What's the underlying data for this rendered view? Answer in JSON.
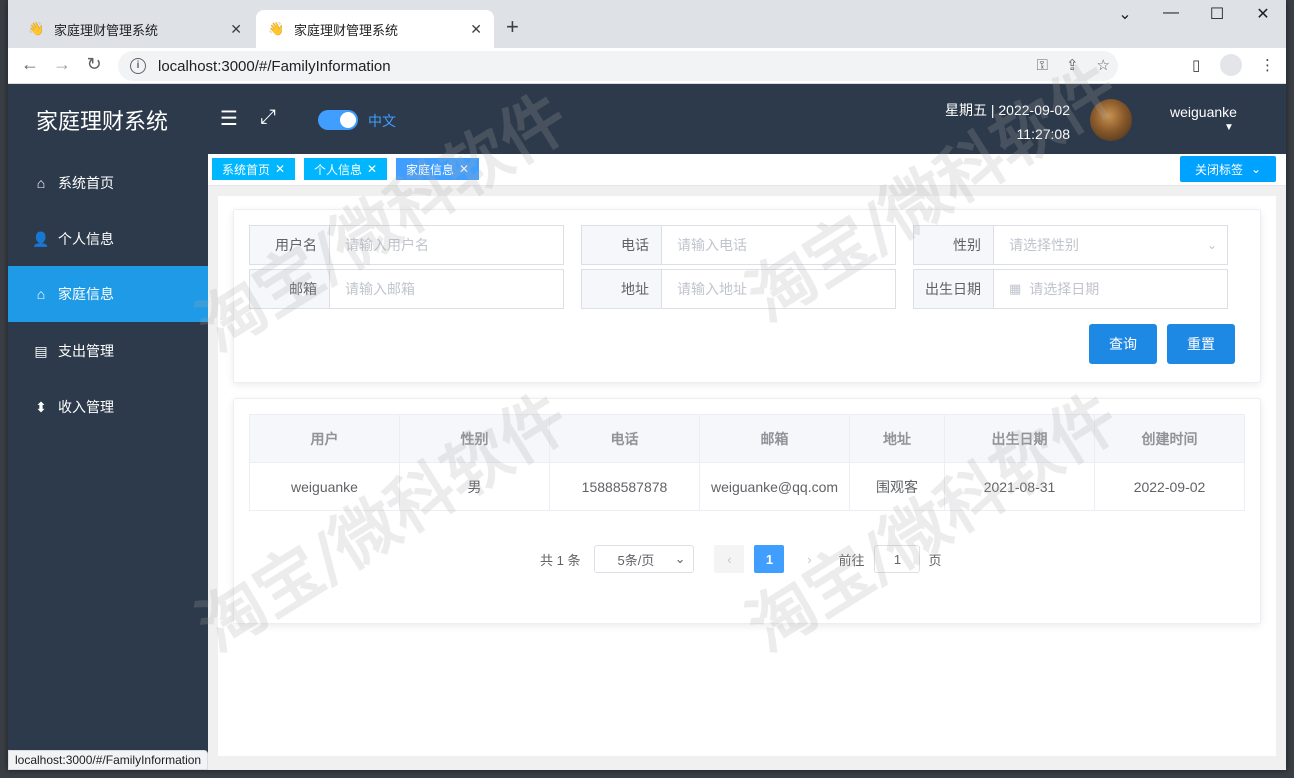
{
  "browser": {
    "tabs": [
      {
        "title": "家庭理财管理系统",
        "close": "✕"
      },
      {
        "title": "家庭理财管理系统",
        "close": "✕"
      }
    ],
    "new_tab": "+",
    "window_controls": {
      "minimize": "—",
      "maximize": "☐",
      "close": "✕"
    },
    "url": "localhost:3000/#/FamilyInformation",
    "status_url": "localhost:3000/#/FamilyInformation"
  },
  "app": {
    "logo": "家庭理财系统",
    "menu": [
      {
        "label": "系统首页",
        "icon": "home-icon"
      },
      {
        "label": "个人信息",
        "icon": "user-icon"
      },
      {
        "label": "家庭信息",
        "icon": "house-icon",
        "active": true
      },
      {
        "label": "支出管理",
        "icon": "document-icon"
      },
      {
        "label": "收入管理",
        "icon": "sort-icon"
      }
    ],
    "language_label": "中文",
    "date_line": "星期五 | 2022-09-02",
    "time_line": "11:27:08",
    "username": "weiguanke",
    "tags": [
      {
        "label": "系统首页"
      },
      {
        "label": "个人信息"
      },
      {
        "label": "家庭信息",
        "active": true
      }
    ],
    "close_tags_label": "关闭标签"
  },
  "search_form": {
    "username": {
      "label": "用户名",
      "placeholder": "请输入用户名"
    },
    "phone": {
      "label": "电话",
      "placeholder": "请输入电话"
    },
    "gender": {
      "label": "性别",
      "placeholder": "请选择性别"
    },
    "email": {
      "label": "邮箱",
      "placeholder": "请输入邮箱"
    },
    "address": {
      "label": "地址",
      "placeholder": "请输入地址"
    },
    "birthdate": {
      "label": "出生日期",
      "placeholder": "请选择日期"
    },
    "query_label": "查询",
    "reset_label": "重置"
  },
  "table": {
    "columns": [
      "用户",
      "性别",
      "电话",
      "邮箱",
      "地址",
      "出生日期",
      "创建时间"
    ],
    "rows": [
      [
        "weiguanke",
        "男",
        "15888587878",
        "weiguanke@qq.com",
        "围观客",
        "2021-08-31",
        "2022-09-02"
      ]
    ]
  },
  "pagination": {
    "total": "共 1 条",
    "page_size": "5条/页",
    "current_page": "1",
    "goto_prefix": "前往",
    "goto_value": "1",
    "goto_suffix": "页"
  },
  "watermark_text": "淘宝/微科软件",
  "colors": {
    "sidebar": "#2d3a4b",
    "accent": "#1e9ae6",
    "tag": "#00a2ff",
    "button": "#1e88e5"
  }
}
